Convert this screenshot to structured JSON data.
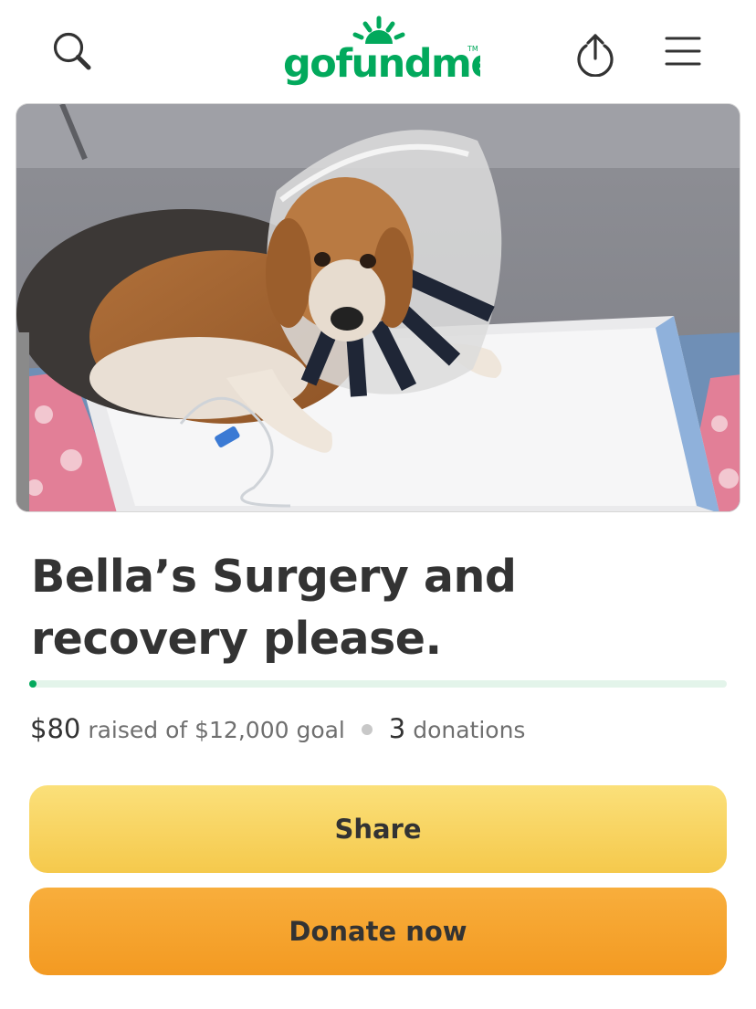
{
  "header": {
    "logo_text": "gofundme",
    "logo_tm": "TM",
    "brand_color": "#02a95c",
    "icons": {
      "search": "search-icon",
      "share": "upload-share-icon",
      "menu": "hamburger-menu-icon"
    }
  },
  "campaign": {
    "title": "Bella’s Surgery and recovery please.",
    "raised_amount": "$80",
    "raised_text": "raised of $12,000 goal",
    "donation_count": "3",
    "donation_label": "donations",
    "progress_fraction": 0.0067
  },
  "actions": {
    "share_label": "Share",
    "donate_label": "Donate now"
  }
}
